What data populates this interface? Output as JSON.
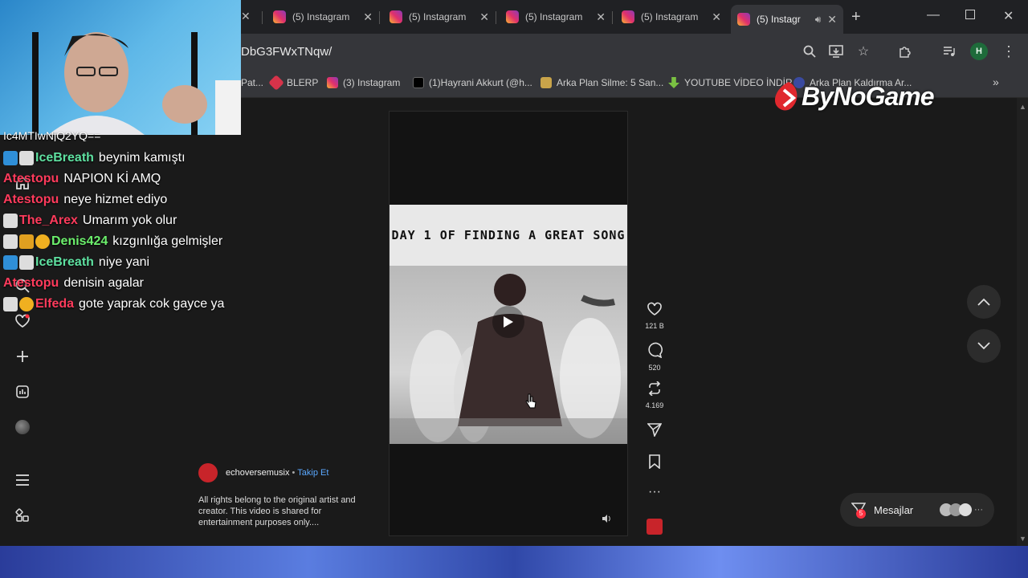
{
  "tabs": [
    {
      "title": "(5) Instagram"
    },
    {
      "title": "(5) Instagram"
    },
    {
      "title": "(5) Instagram"
    },
    {
      "title": "(5) Instagram"
    },
    {
      "title": "(5) Instagr"
    }
  ],
  "address": {
    "url": "DbG3FWxTNqw/"
  },
  "bookmarks": [
    "Pat...",
    "BLERP",
    "(3) Instagram",
    "(1)Hayrani Akkurt (@h...",
    "Arka Plan Silme: 5 San...",
    "YOUTUBE VİDEO İNDİR",
    "Arka Plan Kaldırma Ar..."
  ],
  "profile_initial": "H",
  "brand": {
    "text": "ByNoGame"
  },
  "chat": {
    "partial_line": "Ic4MTIwNjQ2YQ==",
    "messages": [
      {
        "user": "IceBreath",
        "text": "beynim kamıştı",
        "color": "#5ee0a0"
      },
      {
        "user": "Atestopu",
        "text": "NAPION Kİ AMQ",
        "color": "#ff3b5c"
      },
      {
        "user": "Atestopu",
        "text": "neye hizmet ediyo",
        "color": "#ff3b5c"
      },
      {
        "user": "The_Arex",
        "text": "Umarım yok olur",
        "color": "#ff3b5c"
      },
      {
        "user": "Denis424",
        "text": "kızgınlığa gelmişler",
        "color": "#6cf06c"
      },
      {
        "user": "IceBreath",
        "text": "niye yani",
        "color": "#5ee0a0"
      },
      {
        "user": "Atestopu",
        "text": "denisin agalar",
        "color": "#ff3b5c"
      },
      {
        "user": "Elfeda",
        "text": "gote yaprak cok gayce ya",
        "color": "#ff3b5c"
      }
    ]
  },
  "video": {
    "title": "DAY 1 OF FINDING A GREAT SONG"
  },
  "actions": {
    "likes": "121 B",
    "comments": "520",
    "reposts": "4.169"
  },
  "post": {
    "username": "echoversemusix",
    "follow": "Takip Et",
    "separator": "•",
    "caption": "All rights belong to the original artist and creator. This video is shared for entertainment purposes only...."
  },
  "messages_label": "Mesajlar",
  "messages_badge": "5",
  "colors": {
    "accent": "#0095f6",
    "brand_red": "#e0282e"
  }
}
